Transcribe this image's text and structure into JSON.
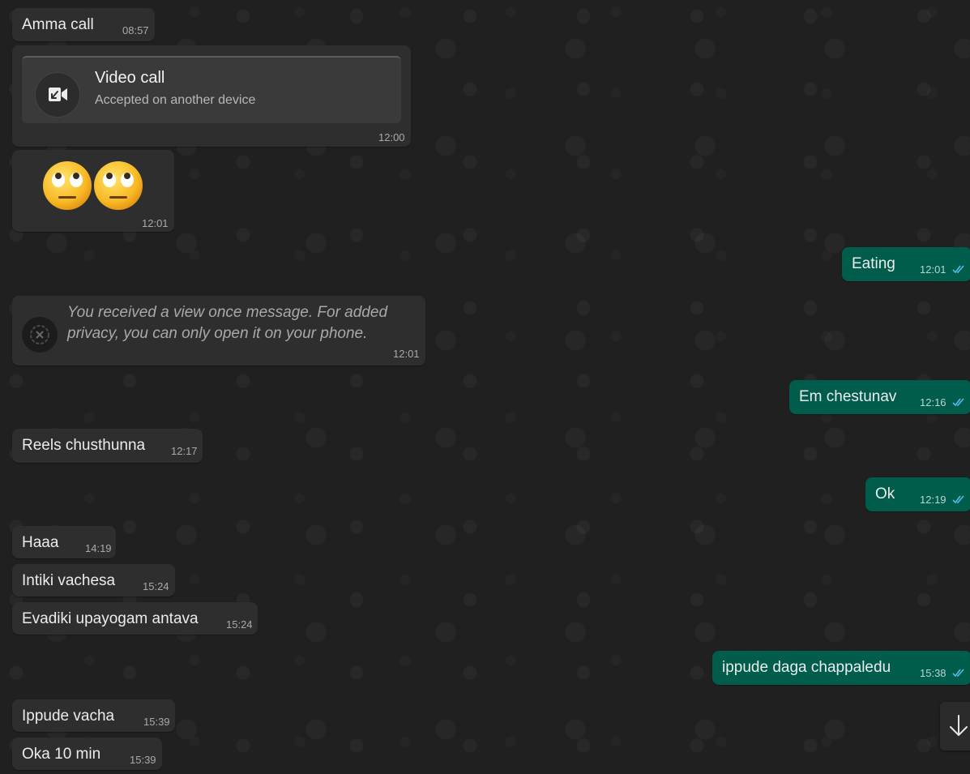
{
  "messages": {
    "m1": {
      "text": "Amma call",
      "time": "08:57"
    },
    "call": {
      "title": "Video call",
      "subtitle": "Accepted on another device",
      "time": "12:00",
      "icon": "video-call-icon"
    },
    "emoji": {
      "glyph": "🙄🙄",
      "time": "12:01"
    },
    "m_eating": {
      "text": "Eating",
      "time": "12:01"
    },
    "view_once": {
      "line1": "You received a view once message. For added",
      "line2": "privacy, you can only open it on your phone.",
      "time": "12:01"
    },
    "m_em": {
      "text": "Em chestunav",
      "time": "12:16"
    },
    "m_reels": {
      "text": "Reels chusthunna",
      "time": "12:17"
    },
    "m_ok": {
      "text": "Ok",
      "time": "12:19"
    },
    "m_haaa": {
      "text": "Haaa",
      "time": "14:19"
    },
    "m_intiki": {
      "text": "Intiki vachesa",
      "time": "15:24"
    },
    "m_evadiki": {
      "text": "Evadiki upayogam antava",
      "time": "15:24"
    },
    "m_ippude_daga": {
      "text": "ippude daga chappaledu",
      "time": "15:38"
    },
    "m_ippude_vacha": {
      "text": "Ippude vacha",
      "time": "15:39"
    },
    "m_oka": {
      "text": "Oka 10 min",
      "time": "15:39"
    }
  },
  "colors": {
    "incoming_bubble": "#2e2e2e",
    "outgoing_bubble": "#005c4b",
    "read_ticks": "#53bdeb"
  },
  "icons": {
    "ticks": "double-check-icon",
    "scroll": "arrow-down-icon"
  }
}
